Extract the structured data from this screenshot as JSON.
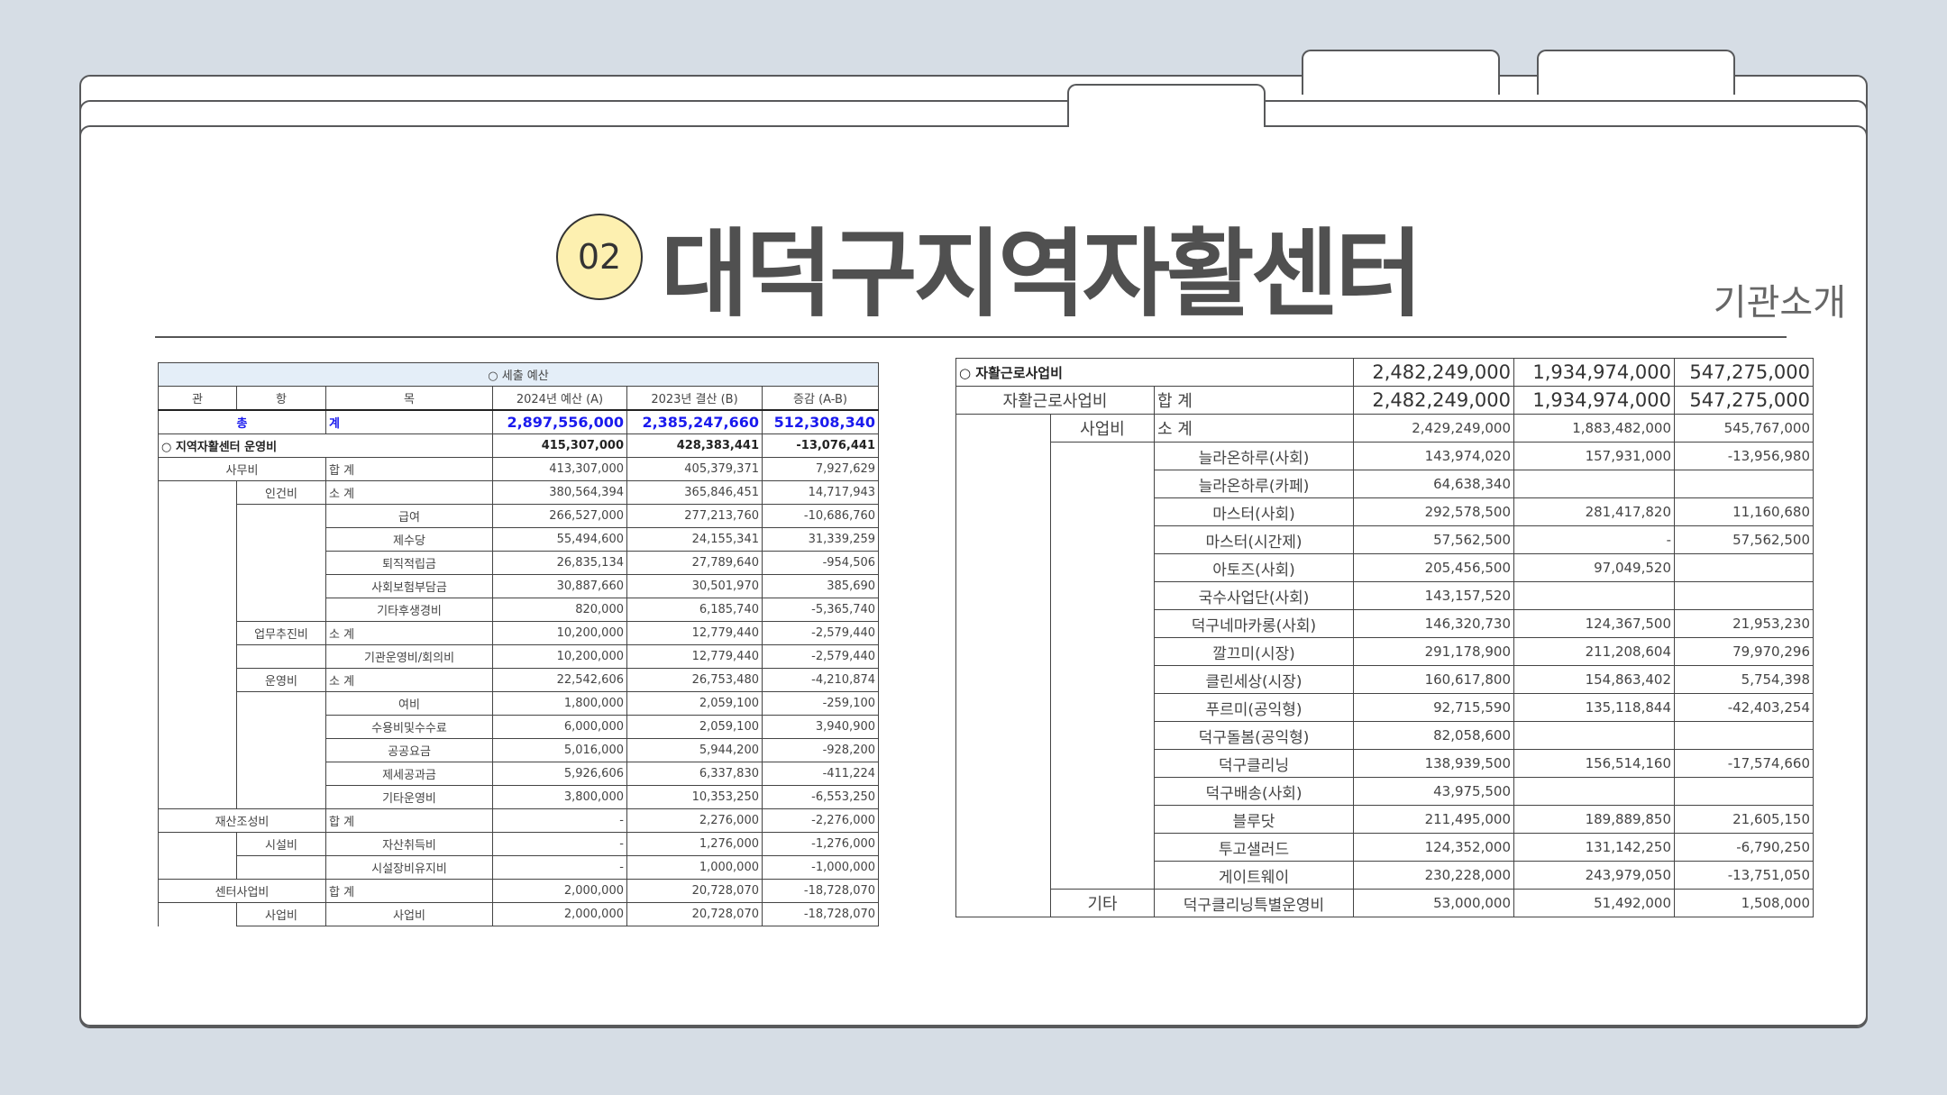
{
  "page": {
    "number": "02",
    "title": "대덕구지역자활센터",
    "subtitle": "기관소개"
  },
  "left_table": {
    "caption": "○ 세출 예산",
    "headers": [
      "관",
      "항",
      "목",
      "2024년 예산 (A)",
      "2023년 결산 (B)",
      "증감 (A-B)"
    ],
    "total": {
      "label_a": "총",
      "label_b": "계",
      "v1": "2,897,556,000",
      "v2": "2,385,247,660",
      "v3": "512,308,340"
    },
    "rows": [
      {
        "kind": "section",
        "a": "○ 지역자활센터 운영비",
        "v1": "415,307,000",
        "v2": "428,383,441",
        "v3": "-13,076,441"
      },
      {
        "kind": "lvl1",
        "a": "사무비",
        "c": "합 계",
        "v1": "413,307,000",
        "v2": "405,379,371",
        "v3": "7,927,629"
      },
      {
        "kind": "lvl2",
        "b": "인건비",
        "c": "소 계",
        "v1": "380,564,394",
        "v2": "365,846,451",
        "v3": "14,717,943"
      },
      {
        "kind": "item",
        "c": "급여",
        "v1": "266,527,000",
        "v2": "277,213,760",
        "v3": "-10,686,760"
      },
      {
        "kind": "item",
        "c": "제수당",
        "v1": "55,494,600",
        "v2": "24,155,341",
        "v3": "31,339,259"
      },
      {
        "kind": "item",
        "c": "퇴직적립금",
        "v1": "26,835,134",
        "v2": "27,789,640",
        "v3": "-954,506"
      },
      {
        "kind": "item",
        "c": "사회보험부담금",
        "v1": "30,887,660",
        "v2": "30,501,970",
        "v3": "385,690"
      },
      {
        "kind": "item",
        "c": "기타후생경비",
        "v1": "820,000",
        "v2": "6,185,740",
        "v3": "-5,365,740"
      },
      {
        "kind": "lvl2",
        "b": "업무추진비",
        "c": "소 계",
        "v1": "10,200,000",
        "v2": "12,779,440",
        "v3": "-2,579,440"
      },
      {
        "kind": "item",
        "c": "기관운영비/회의비",
        "v1": "10,200,000",
        "v2": "12,779,440",
        "v3": "-2,579,440"
      },
      {
        "kind": "lvl2",
        "b": "운영비",
        "c": "소 계",
        "v1": "22,542,606",
        "v2": "26,753,480",
        "v3": "-4,210,874"
      },
      {
        "kind": "item",
        "c": "여비",
        "v1": "1,800,000",
        "v2": "2,059,100",
        "v3": "-259,100"
      },
      {
        "kind": "item",
        "c": "수용비및수수료",
        "v1": "6,000,000",
        "v2": "2,059,100",
        "v3": "3,940,900"
      },
      {
        "kind": "item",
        "c": "공공요금",
        "v1": "5,016,000",
        "v2": "5,944,200",
        "v3": "-928,200"
      },
      {
        "kind": "item",
        "c": "제세공과금",
        "v1": "5,926,606",
        "v2": "6,337,830",
        "v3": "-411,224"
      },
      {
        "kind": "item",
        "c": "기타운영비",
        "v1": "3,800,000",
        "v2": "10,353,250",
        "v3": "-6,553,250"
      },
      {
        "kind": "lvl1",
        "a": "재산조성비",
        "c": "합 계",
        "v1": "-",
        "v2": "2,276,000",
        "v3": "-2,276,000"
      },
      {
        "kind": "lvl2",
        "b": "시설비",
        "c": "자산취득비",
        "v1": "-",
        "v2": "1,276,000",
        "v3": "-1,276,000"
      },
      {
        "kind": "item",
        "c": "시설장비유지비",
        "v1": "-",
        "v2": "1,000,000",
        "v3": "-1,000,000"
      },
      {
        "kind": "lvl1",
        "a": "센터사업비",
        "c": "합 계",
        "v1": "2,000,000",
        "v2": "20,728,070",
        "v3": "-18,728,070"
      },
      {
        "kind": "lvl2",
        "b": "사업비",
        "c": "사업비",
        "v1": "2,000,000",
        "v2": "20,728,070",
        "v3": "-18,728,070"
      }
    ]
  },
  "right_table": {
    "header": {
      "label": "○ 자활근로사업비",
      "v1": "2,482,249,000",
      "v2": "1,934,974,000",
      "v3": "547,275,000"
    },
    "subheader": {
      "a": "자활근로사업비",
      "c": "합 계",
      "v1": "2,482,249,000",
      "v2": "1,934,974,000",
      "v3": "547,275,000"
    },
    "subtotal": {
      "b": "사업비",
      "c": "소 계",
      "v1": "2,429,249,000",
      "v2": "1,883,482,000",
      "v3": "545,767,000"
    },
    "items": [
      {
        "c": "늘라온하루(사회)",
        "v1": "143,974,020",
        "v2": "157,931,000",
        "v3": "-13,956,980"
      },
      {
        "c": "늘라온하루(카페)",
        "v1": "64,638,340",
        "v2": "",
        "v3": ""
      },
      {
        "c": "마스터(사회)",
        "v1": "292,578,500",
        "v2": "281,417,820",
        "v3": "11,160,680"
      },
      {
        "c": "마스터(시간제)",
        "v1": "57,562,500",
        "v2": "-",
        "v3": "57,562,500"
      },
      {
        "c": "아토즈(사회)",
        "v1": "205,456,500",
        "v2": "97,049,520",
        "v3": ""
      },
      {
        "c": "국수사업단(사회)",
        "v1": "143,157,520",
        "v2": "",
        "v3": ""
      },
      {
        "c": "덕구네마카롱(사회)",
        "v1": "146,320,730",
        "v2": "124,367,500",
        "v3": "21,953,230"
      },
      {
        "c": "깔끄미(시장)",
        "v1": "291,178,900",
        "v2": "211,208,604",
        "v3": "79,970,296"
      },
      {
        "c": "클린세상(시장)",
        "v1": "160,617,800",
        "v2": "154,863,402",
        "v3": "5,754,398"
      },
      {
        "c": "푸르미(공익형)",
        "v1": "92,715,590",
        "v2": "135,118,844",
        "v3": "-42,403,254"
      },
      {
        "c": "덕구돌봄(공익형)",
        "v1": "82,058,600",
        "v2": "",
        "v3": ""
      },
      {
        "c": "덕구클리닝",
        "v1": "138,939,500",
        "v2": "156,514,160",
        "v3": "-17,574,660"
      },
      {
        "c": "덕구배송(사회)",
        "v1": "43,975,500",
        "v2": "",
        "v3": ""
      },
      {
        "c": "블루닷",
        "v1": "211,495,000",
        "v2": "189,889,850",
        "v3": "21,605,150"
      },
      {
        "c": "투고샐러드",
        "v1": "124,352,000",
        "v2": "131,142,250",
        "v3": "-6,790,250"
      },
      {
        "c": "게이트웨이",
        "v1": "230,228,000",
        "v2": "243,979,050",
        "v3": "-13,751,050"
      }
    ],
    "other": {
      "b": "기타",
      "c": "덕구클리닝특별운영비",
      "v1": "53,000,000",
      "v2": "51,492,000",
      "v3": "1,508,000"
    }
  }
}
